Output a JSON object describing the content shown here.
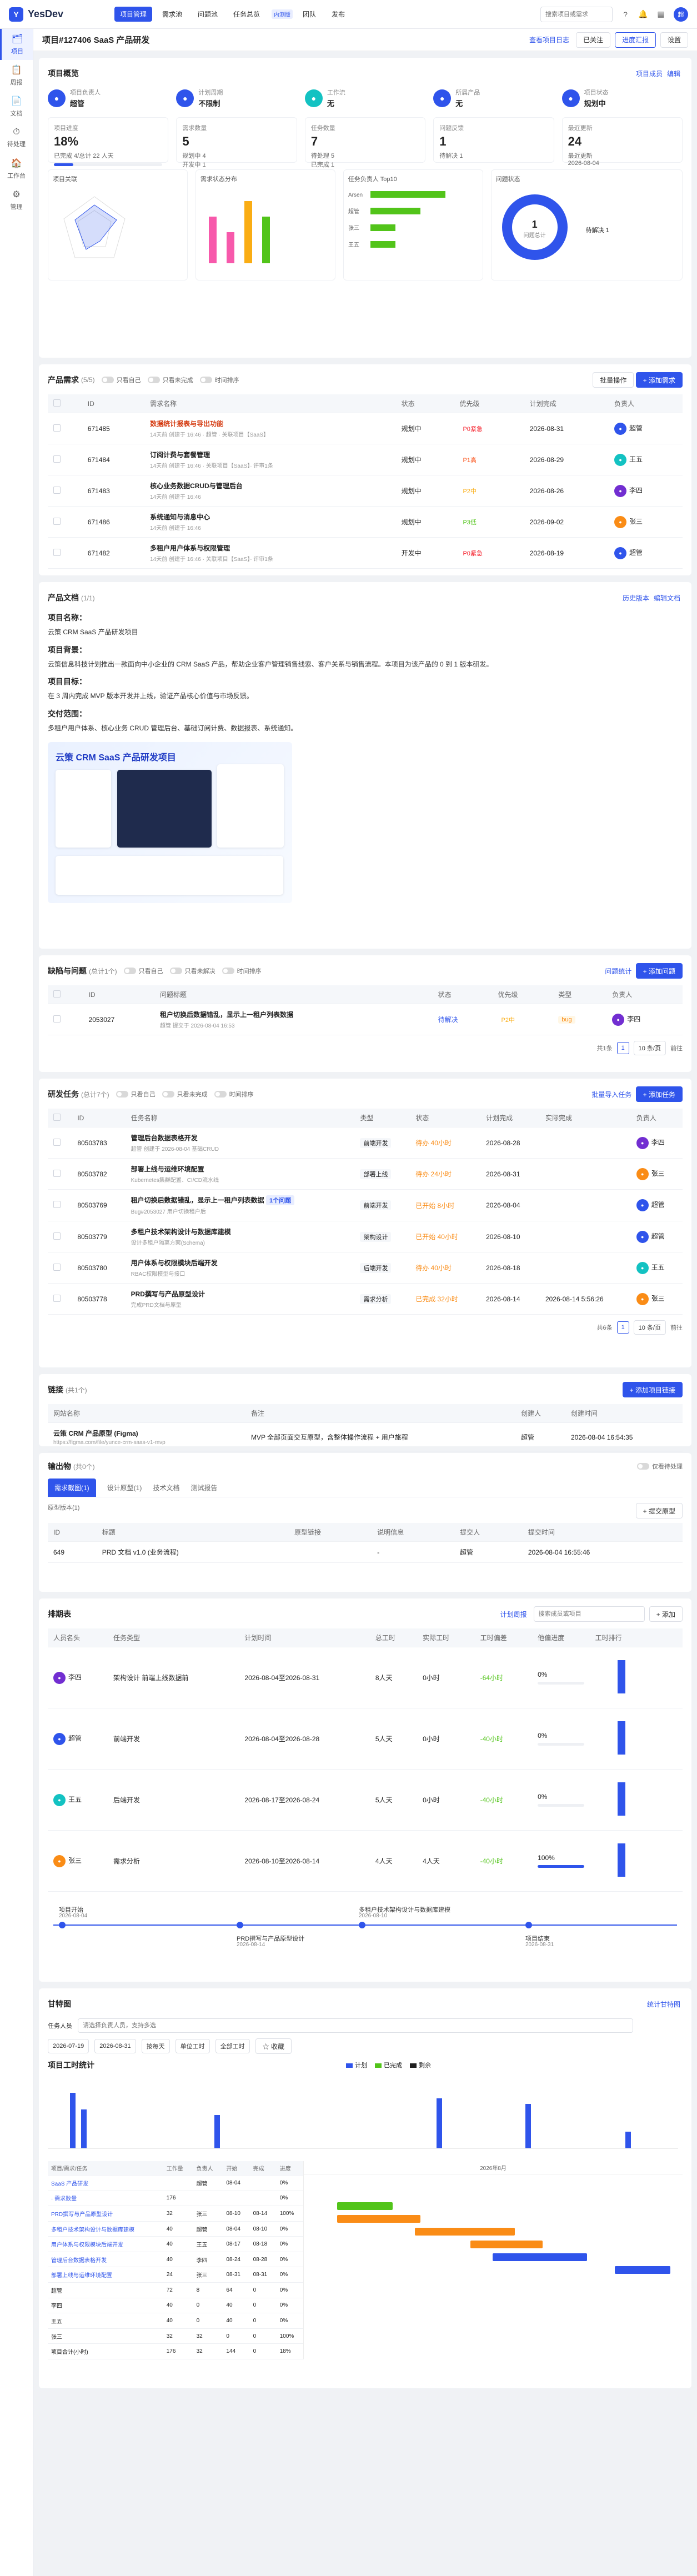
{
  "app": {
    "name": "YesDev",
    "logo": "Y"
  },
  "topnav": [
    {
      "label": "项目管理",
      "active": true
    },
    {
      "label": "需求池"
    },
    {
      "label": "问题池"
    },
    {
      "label": "任务总览",
      "badge": "内测版"
    },
    {
      "label": "团队"
    },
    {
      "label": "发布"
    }
  ],
  "search": {
    "placeholder": "搜索项目或需求"
  },
  "user": {
    "initial": "超"
  },
  "sidebar": [
    {
      "label": "项目",
      "icon": "🗂",
      "active": true
    },
    {
      "label": "周报",
      "icon": "📋"
    },
    {
      "label": "文档",
      "icon": "📄"
    },
    {
      "label": "待处理",
      "icon": "⏱"
    },
    {
      "label": "工作台",
      "icon": "🏠"
    },
    {
      "label": "管理",
      "icon": "⚙"
    }
  ],
  "project": {
    "title": "项目#127406 SaaS 产品研发",
    "share": "查看项目日志",
    "star": "已关注",
    "progress": "进度汇报",
    "settings": "设置"
  },
  "overview": {
    "title": "项目概览",
    "btn_member": "项目成员",
    "btn_edit": "编辑",
    "info": [
      {
        "label": "项目负责人",
        "value": "超管",
        "color": "#2f54eb"
      },
      {
        "label": "计划周期",
        "value": "不限制",
        "color": "#2f54eb"
      },
      {
        "label": "工作流",
        "value": "无",
        "color": "#13c2c2"
      },
      {
        "label": "所属产品",
        "value": "无",
        "color": "#2f54eb"
      },
      {
        "label": "项目状态",
        "value": "规划中",
        "color": "#2f54eb"
      }
    ],
    "stats": [
      {
        "label": "项目进度",
        "num": "18%",
        "sub": "已完成 4/总计 22 人天",
        "progress": 18
      },
      {
        "label": "需求数量",
        "num": "5",
        "sub1": "规划中 4",
        "sub2": "开发中 1"
      },
      {
        "label": "任务数量",
        "num": "7",
        "sub1": "待处理 5",
        "sub2": "已完成 1"
      },
      {
        "label": "问题反馈",
        "num": "1",
        "sub1": "待解决 1"
      },
      {
        "label": "最近更新",
        "num": "24",
        "sub1": "最近更新",
        "sub2": "2026-08-04"
      }
    ],
    "radar_title": "项目关联",
    "bar_title": "需求状态分布",
    "hbar_title": "任务负责人 Top10",
    "donut_title": "问题状态",
    "donut_center": "1",
    "donut_sub": "问题总计",
    "donut_legend": "待解决 1",
    "hbar": [
      {
        "name": "Arsen",
        "v": 3
      },
      {
        "name": "超管",
        "v": 2
      },
      {
        "name": "张三",
        "v": 1
      },
      {
        "name": "王五",
        "v": 1
      }
    ],
    "vbar": [
      {
        "c": "#f759ab",
        "v": 3
      },
      {
        "c": "#f759ab",
        "v": 2
      },
      {
        "c": "#faad14",
        "v": 4
      },
      {
        "c": "#52c41a",
        "v": 3
      }
    ]
  },
  "requirements": {
    "title": "产品需求",
    "count": "(5/5)",
    "toggles": [
      "只看自己",
      "只看未完成",
      "时间排序"
    ],
    "add": "+ 添加需求",
    "batch": "批量操作",
    "cols": [
      "ID",
      "需求名称",
      "状态",
      "优先级",
      "计划完成",
      "负责人"
    ],
    "rows": [
      {
        "id": "671485",
        "name": "数据统计报表与导出功能",
        "sub": "14天前 创建于 16:46 · 超管 · 关联项目【SaaS】",
        "status": "规划中",
        "pri": "P0紧急",
        "pc": "p0",
        "date": "2026-08-31",
        "owner": "超管",
        "oc": "#2f54eb",
        "red": true
      },
      {
        "id": "671484",
        "name": "订阅计费与套餐管理",
        "sub": "14天前 创建于 16:46 · 关联项目【SaaS】· 评审1条",
        "status": "规划中",
        "pri": "P1高",
        "pc": "p1",
        "date": "2026-08-29",
        "owner": "王五",
        "oc": "#13c2c2"
      },
      {
        "id": "671483",
        "name": "核心业务数据CRUD与管理后台",
        "sub": "14天前 创建于 16:46",
        "status": "规划中",
        "pri": "P2中",
        "pc": "p2",
        "date": "2026-08-26",
        "owner": "李四",
        "oc": "#722ed1"
      },
      {
        "id": "671486",
        "name": "系统通知与消息中心",
        "sub": "14天前 创建于 16:46",
        "status": "规划中",
        "pri": "P3低",
        "pc": "p3",
        "date": "2026-09-02",
        "owner": "张三",
        "oc": "#fa8c16"
      },
      {
        "id": "671482",
        "name": "多租户用户体系与权限管理",
        "sub": "14天前 创建于 16:46 · 关联项目【SaaS】· 评审1条",
        "status": "开发中",
        "pri": "P0紧急",
        "pc": "p0",
        "date": "2026-08-19",
        "owner": "超管",
        "oc": "#2f54eb"
      }
    ]
  },
  "doc": {
    "title": "产品文档",
    "count": "(1/1)",
    "btn_history": "历史版本",
    "btn_edit": "编辑文档",
    "h1": "项目名称：",
    "p1": "云策 CRM SaaS 产品研发项目",
    "h2": "项目背景：",
    "p2": "云策信息科技计划推出一款面向中小企业的 CRM SaaS 产品，帮助企业客户管理销售线索、客户关系与销售流程。本项目为该产品的 0 到 1 版本研发。",
    "h3": "项目目标：",
    "p3": "在 3 周内完成 MVP 版本开发并上线，验证产品核心价值与市场反馈。",
    "h4": "交付范围：",
    "p4": "多租户用户体系、核心业务 CRUD 管理后台、基础订阅计费、数据报表、系统通知。",
    "banner_title": "云策 CRM SaaS 产品研发项目"
  },
  "issues": {
    "title": "缺陷与问题",
    "count": "(总计1个)",
    "toggles": [
      "只看自己",
      "只看未解决",
      "时间排序"
    ],
    "btn_link": "问题统计",
    "add": "+ 添加问题",
    "cols": [
      "ID",
      "问题标题",
      "状态",
      "优先级",
      "类型",
      "负责人"
    ],
    "rows": [
      {
        "id": "2053027",
        "name": "租户切换后数据错乱，显示上一租户列表数据",
        "sub": "超管 提交于 2026-08-04 16:53",
        "status": "待解决",
        "pri": "P2中",
        "type": "bug",
        "owner": "李四",
        "oc": "#722ed1"
      }
    ],
    "pager": {
      "total": "共1条",
      "size": "10 条/页",
      "goto": "前往",
      "page": "1"
    }
  },
  "tasks": {
    "title": "研发任务",
    "count": "(总计7个)",
    "toggles": [
      "只看自己",
      "只看未完成",
      "时间排序"
    ],
    "tags": [
      "产品研发",
      "研发任务"
    ],
    "btn_link": "批量导入任务",
    "add": "+ 添加任务",
    "cols": [
      "ID",
      "任务名称",
      "类型",
      "状态",
      "计划完成",
      "实际完成",
      "负责人"
    ],
    "rows": [
      {
        "id": "80503783",
        "name": "管理后台数据表格开发",
        "sub": "超管 创建于 2026-08-04 基础CRUD",
        "type": "前端开发",
        "status": "待办 40小时",
        "date": "2026-08-28",
        "adate": "",
        "owner": "李四",
        "oc": "#722ed1"
      },
      {
        "id": "80503782",
        "name": "部署上线与运维环境配置",
        "sub": "Kubernetes集群配置、CI/CD流水线",
        "type": "部署上线",
        "status": "待办 24小时",
        "date": "2026-08-31",
        "adate": "",
        "owner": "张三",
        "oc": "#fa8c16"
      },
      {
        "id": "80503769",
        "name": "租户切换后数据错乱，显示上一租户列表数据",
        "sub": "Bug#2053027 用户切换租户后",
        "type": "前端开发",
        "status": "已开始 8小时",
        "date": "2026-08-04",
        "adate": "",
        "owner": "超管",
        "oc": "#2f54eb",
        "tag": "1个问题"
      },
      {
        "id": "80503779",
        "name": "多租户技术架构设计与数据库建模",
        "sub": "设计多租户隔离方案(Schema)",
        "type": "架构设计",
        "status": "已开始 40小时",
        "date": "2026-08-10",
        "adate": "",
        "owner": "超管",
        "oc": "#2f54eb"
      },
      {
        "id": "80503780",
        "name": "用户体系与权限模块后端开发",
        "sub": "RBAC权限模型与接口",
        "type": "后端开发",
        "status": "待办 40小时",
        "date": "2026-08-18",
        "adate": "",
        "owner": "王五",
        "oc": "#13c2c2"
      },
      {
        "id": "80503778",
        "name": "PRD撰写与产品原型设计",
        "sub": "完成PRD文档与原型",
        "type": "需求分析",
        "status": "已完成 32小时",
        "date": "2026-08-14",
        "adate": "2026-08-14 5:56:26",
        "owner": "张三",
        "oc": "#fa8c16"
      }
    ],
    "pager": {
      "total": "共6条",
      "size": "10 条/页",
      "goto": "前往",
      "page": "1"
    }
  },
  "links": {
    "title": "链接",
    "count": "(共1个)",
    "add": "+ 添加项目链接",
    "cols": [
      "网站名称",
      "备注",
      "创建人",
      "创建时间"
    ],
    "rows": [
      {
        "name": "云策 CRM 产品原型 (Figma)",
        "url": "https://figma.com/file/yunce-crm-saas-v1-mvp",
        "note": "MVP 全部页面交互原型，含整体操作流程 + 用户旅程",
        "creator": "超管",
        "time": "2026-08-04 16:54:35"
      }
    ]
  },
  "deliver": {
    "title": "输出物",
    "count": "(共0个)",
    "toggle": "仅看待处理",
    "tabs": [
      "需求截图(1)",
      "设计原型(1)",
      "技术文档",
      "测试报告"
    ],
    "sub": "原型版本(1)",
    "add": "+ 提交原型",
    "cols": [
      "ID",
      "标题",
      "原型链接",
      "说明信息",
      "提交人",
      "提交时间"
    ],
    "rows": [
      {
        "id": "649",
        "name": "PRD 文档 v1.0 (业务流程)",
        "link": "",
        "desc": "-",
        "owner": "超管",
        "time": "2026-08-04 16:55:46"
      }
    ]
  },
  "schedule": {
    "title": "排期表",
    "btn_link": "计划周报",
    "search": "搜索成员或项目",
    "btn": "+ 添加",
    "cols": [
      "人员名头",
      "任务类型",
      "计划时间",
      "总工时",
      "实际工时",
      "工时偏差",
      "他偏进度",
      "工时排行"
    ],
    "rows": [
      {
        "name": "李四",
        "oc": "#722ed1",
        "type": "架构设计 前端上线数据前",
        "time": "2026-08-04至2026-08-31",
        "plan": "8人天",
        "act": "0小时",
        "dev": "-64小时",
        "prog": "0%"
      },
      {
        "name": "超管",
        "oc": "#2f54eb",
        "type": "前端开发",
        "time": "2026-08-04至2026-08-28",
        "plan": "5人天",
        "act": "0小时",
        "dev": "-40小时",
        "prog": "0%"
      },
      {
        "name": "王五",
        "oc": "#13c2c2",
        "type": "后端开发",
        "time": "2026-08-17至2026-08-24",
        "plan": "5人天",
        "act": "0小时",
        "dev": "-40小时",
        "prog": "0%"
      },
      {
        "name": "张三",
        "oc": "#fa8c16",
        "type": "需求分析",
        "time": "2026-08-10至2026-08-14",
        "plan": "4人天",
        "act": "4人天",
        "dev": "-40小时",
        "prog": "100%"
      }
    ],
    "tl": [
      {
        "label": "项目开始",
        "date": "2026-08-04"
      },
      {
        "label": "PRD撰写与产品原型设计",
        "date": "2026-08-14"
      },
      {
        "label": "多租户技术架构设计与数据库建模",
        "date": "2026-08-10"
      },
      {
        "label": "项目结束",
        "date": "2026-08-31"
      }
    ]
  },
  "gantt": {
    "title": "甘特图",
    "btn_link": "统计甘特图",
    "filter_label": "任务人员",
    "filter_ph": "请选择负责人员，支持多选",
    "start": "2026-07-19",
    "end": "2026-08-31",
    "mode": "按每天",
    "scope": "单位工时",
    "plan": "全部工时",
    "btn": "☆ 收藏",
    "chart_title": "项目工时统计",
    "legend": [
      "计划",
      "已完成",
      "剩余"
    ],
    "left_cols": [
      "项目/需求/任务",
      "工作量",
      "负责人",
      "开始",
      "完成",
      "进度"
    ],
    "left_rows": [
      {
        "n": "SaaS 产品研发",
        "w": "",
        "o": "超管",
        "s": "08-04",
        "e": "",
        "p": "0%"
      },
      {
        "n": "· 需求数量",
        "w": "176",
        "o": "",
        "s": "",
        "e": "",
        "p": "0%"
      },
      {
        "n": "PRD撰写与产品原型设计",
        "w": "32",
        "o": "张三",
        "s": "08-10",
        "e": "08-14",
        "p": "100%"
      },
      {
        "n": "多租户技术架构设计与数据库建模",
        "w": "40",
        "o": "超管",
        "s": "08-04",
        "e": "08-10",
        "p": "0%"
      },
      {
        "n": "用户体系与权限模块后端开发",
        "w": "40",
        "o": "王五",
        "s": "08-17",
        "e": "08-18",
        "p": "0%"
      },
      {
        "n": "管理后台数据表格开发",
        "w": "40",
        "o": "李四",
        "s": "08-24",
        "e": "08-28",
        "p": "0%"
      },
      {
        "n": "部署上线与运维环境配置",
        "w": "24",
        "o": "张三",
        "s": "08-31",
        "e": "08-31",
        "p": "0%"
      }
    ],
    "p_rows": [
      {
        "n": "超管",
        "w": "72",
        "o": "8",
        "s": "64",
        "e": "0",
        "p": "0%"
      },
      {
        "n": "李四",
        "w": "40",
        "o": "0",
        "s": "40",
        "e": "0",
        "p": "0%"
      },
      {
        "n": "王五",
        "w": "40",
        "o": "0",
        "s": "40",
        "e": "0",
        "p": "0%"
      },
      {
        "n": "张三",
        "w": "32",
        "o": "32",
        "s": "0",
        "e": "0",
        "p": "100%"
      },
      {
        "n": "项目合计(小时)",
        "w": "176",
        "o": "32",
        "s": "144",
        "e": "0",
        "p": "18%"
      }
    ],
    "month": "2026年8月"
  },
  "chart_data": [
    {
      "type": "bar",
      "title": "项目工时统计",
      "series": [
        {
          "name": "计划",
          "color": "#2f54eb"
        },
        {
          "name": "已完成",
          "color": "#52c41a"
        },
        {
          "name": "剩余",
          "color": "#1f1f1f"
        }
      ]
    }
  ]
}
